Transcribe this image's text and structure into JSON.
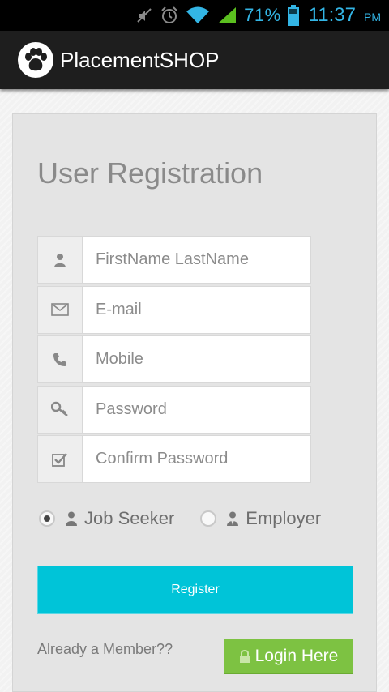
{
  "status_bar": {
    "battery_percent": "71%",
    "time": "11:37",
    "ampm": "PM",
    "icons": [
      "mute-icon",
      "alarm-icon",
      "wifi-icon",
      "signal-icon",
      "battery-icon"
    ],
    "accent_color": "#33b5e5"
  },
  "app_bar": {
    "title": "PlacementSHOP",
    "logo_icon": "paw-icon"
  },
  "form": {
    "heading": "User Registration",
    "fields": [
      {
        "placeholder": "FirstName LastName",
        "value": "",
        "icon": "user-icon"
      },
      {
        "placeholder": "E-mail",
        "value": "",
        "icon": "envelope-icon"
      },
      {
        "placeholder": "Mobile",
        "value": "",
        "icon": "phone-icon"
      },
      {
        "placeholder": "Password",
        "value": "",
        "icon": "key-icon"
      },
      {
        "placeholder": "Confirm Password",
        "value": "",
        "icon": "check-square-icon"
      }
    ],
    "roles": [
      {
        "label": "Job Seeker",
        "selected": true,
        "icon": "user-icon"
      },
      {
        "label": "Employer",
        "selected": false,
        "icon": "user-tie-icon"
      }
    ],
    "register_label": "Register",
    "register_color": "#00c4d8"
  },
  "footer": {
    "member_text": "Already a Member??",
    "login_label": "Login Here",
    "login_icon": "lock-icon",
    "login_color": "#7dc242"
  }
}
